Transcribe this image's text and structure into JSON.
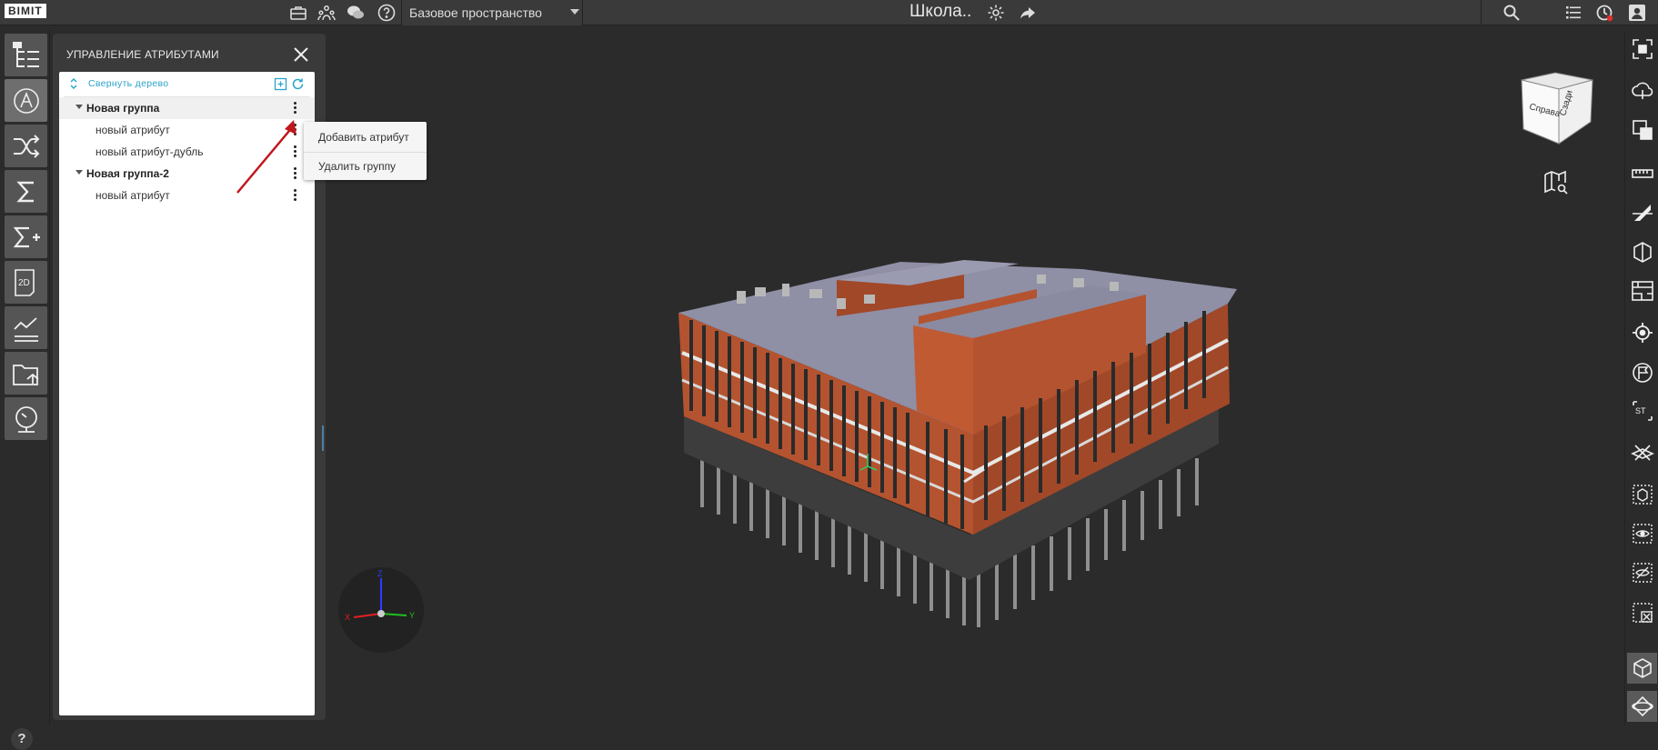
{
  "app": {
    "logo": "BIMIT",
    "space": "Базовое пространство",
    "project_title": "Школа.."
  },
  "panel": {
    "title": "Управление атрибутами",
    "collapse_label": "Свернуть дерево",
    "tree": [
      {
        "type": "group",
        "label": "Новая группа"
      },
      {
        "type": "item",
        "label": "новый атрибут"
      },
      {
        "type": "item",
        "label": "новый атрибут-дубль"
      },
      {
        "type": "group",
        "label": "Новая группа-2"
      },
      {
        "type": "item",
        "label": "новый атрибут"
      }
    ]
  },
  "context_menu": {
    "add_attribute": "Добавить атрибут",
    "delete_group": "Удалить группу"
  },
  "viewer": {
    "navcube_left": "Справа",
    "navcube_right": "Сзади",
    "axis_x": "X",
    "axis_y": "Y",
    "axis_z": "Z"
  },
  "help": "?",
  "colors": {
    "accent": "#2aa3c9",
    "panel_bg": "#3a3a3a",
    "viewport_bg": "#2b2b2b",
    "brick": "#b4532f",
    "arrow": "#c0161d"
  }
}
